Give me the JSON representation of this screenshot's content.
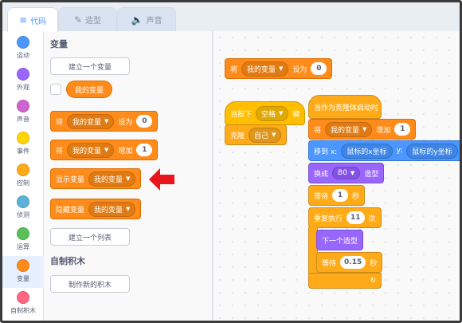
{
  "tabs": {
    "code": "代码",
    "costumes": "造型",
    "sounds": "声音"
  },
  "categories": [
    {
      "label": "运动",
      "color": "#4c97ff"
    },
    {
      "label": "外观",
      "color": "#9966ff"
    },
    {
      "label": "声音",
      "color": "#cf63cf"
    },
    {
      "label": "事件",
      "color": "#ffd500"
    },
    {
      "label": "控制",
      "color": "#ffab19"
    },
    {
      "label": "侦测",
      "color": "#5cb1d6"
    },
    {
      "label": "运算",
      "color": "#59c059"
    },
    {
      "label": "变量",
      "color": "#ff8c1a"
    },
    {
      "label": "自制积木",
      "color": "#ff6680"
    }
  ],
  "palette": {
    "variables_title": "变量",
    "make_variable": "建立一个变量",
    "my_variable": "我的变量",
    "set_label": "将",
    "set_to": "设为",
    "set_value": "0",
    "change_label": "将",
    "change_by": "增加",
    "change_value": "1",
    "show_variable": "显示变量",
    "hide_variable": "隐藏变量",
    "make_list": "建立一个列表",
    "myblocks_title": "自制积木",
    "make_block": "制作新的积木"
  },
  "workspace": {
    "set_block": {
      "label": "将",
      "var": "我的变量",
      "to": "设为",
      "value": "0"
    },
    "key_hat": {
      "label": "当按下",
      "key": "空格",
      "suffix": "键"
    },
    "clone": {
      "label": "克隆",
      "target": "自己"
    },
    "clone_hat": "当作为克隆体启动时",
    "change_block": {
      "label": "将",
      "var": "我的变量",
      "by": "增加",
      "value": "1"
    },
    "goto": {
      "label": "移到 x:",
      "x": "鼠标的x坐标",
      "ylabel": "y:",
      "y": "鼠标的y坐标"
    },
    "switch_costume": {
      "label": "换成",
      "costume": "B0",
      "suffix": "造型"
    },
    "wait1": {
      "label": "等待",
      "value": "1",
      "suffix": "秒"
    },
    "repeat": {
      "label": "重复执行",
      "value": "11",
      "suffix": "次"
    },
    "next_costume": "下一个造型",
    "wait2": {
      "label": "等待",
      "value": "0.15",
      "suffix": "秒"
    }
  }
}
